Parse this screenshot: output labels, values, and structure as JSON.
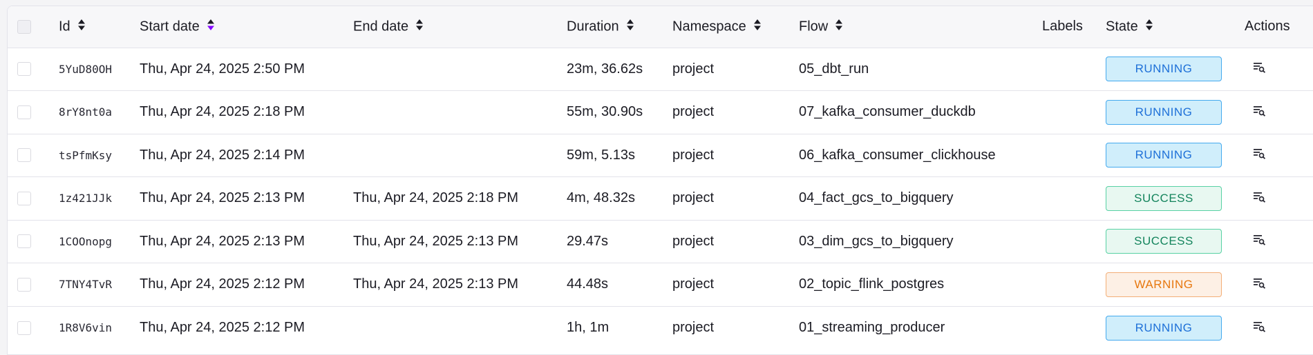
{
  "columns": {
    "id": "Id",
    "start_date": "Start date",
    "end_date": "End date",
    "duration": "Duration",
    "namespace": "Namespace",
    "flow": "Flow",
    "labels": "Labels",
    "state": "State",
    "actions": "Actions"
  },
  "sorted_column": "start_date",
  "colors": {
    "sort_active": "#8405ff",
    "running_bg": "#d0eefb",
    "running_border": "#43a9ee",
    "running_text": "#1e70d8",
    "success_bg": "#e8f8f1",
    "success_border": "#57d1a3",
    "success_text": "#13845c",
    "warning_bg": "#fdf0e5",
    "warning_border": "#f3ae76",
    "warning_text": "#e7780f"
  },
  "rows": [
    {
      "id": "5YuD80OH",
      "start": "Thu, Apr 24, 2025 2:50 PM",
      "end": "",
      "duration": "23m, 36.62s",
      "namespace": "project",
      "flow": "05_dbt_run",
      "state": "RUNNING",
      "action_icon": "logs-search-icon"
    },
    {
      "id": "8rY8nt0a",
      "start": "Thu, Apr 24, 2025 2:18 PM",
      "end": "",
      "duration": "55m, 30.90s",
      "namespace": "project",
      "flow": "07_kafka_consumer_duckdb",
      "state": "RUNNING",
      "action_icon": "logs-search-icon"
    },
    {
      "id": "tsPfmKsy",
      "start": "Thu, Apr 24, 2025 2:14 PM",
      "end": "",
      "duration": "59m, 5.13s",
      "namespace": "project",
      "flow": "06_kafka_consumer_clickhouse",
      "state": "RUNNING",
      "action_icon": "logs-search-icon"
    },
    {
      "id": "1z421JJk",
      "start": "Thu, Apr 24, 2025 2:13 PM",
      "end": "Thu, Apr 24, 2025 2:18 PM",
      "duration": "4m, 48.32s",
      "namespace": "project",
      "flow": "04_fact_gcs_to_bigquery",
      "state": "SUCCESS",
      "action_icon": "logs-search-icon"
    },
    {
      "id": "1COOnopg",
      "start": "Thu, Apr 24, 2025 2:13 PM",
      "end": "Thu, Apr 24, 2025 2:13 PM",
      "duration": "29.47s",
      "namespace": "project",
      "flow": "03_dim_gcs_to_bigquery",
      "state": "SUCCESS",
      "action_icon": "logs-search-icon"
    },
    {
      "id": "7TNY4TvR",
      "start": "Thu, Apr 24, 2025 2:12 PM",
      "end": "Thu, Apr 24, 2025 2:13 PM",
      "duration": "44.48s",
      "namespace": "project",
      "flow": "02_topic_flink_postgres",
      "state": "WARNING",
      "action_icon": "logs-search-icon"
    },
    {
      "id": "1R8V6vin",
      "start": "Thu, Apr 24, 2025 2:12 PM",
      "end": "",
      "duration": "1h, 1m",
      "namespace": "project",
      "flow": "01_streaming_producer",
      "state": "RUNNING",
      "action_icon": "logs-search-icon"
    }
  ]
}
